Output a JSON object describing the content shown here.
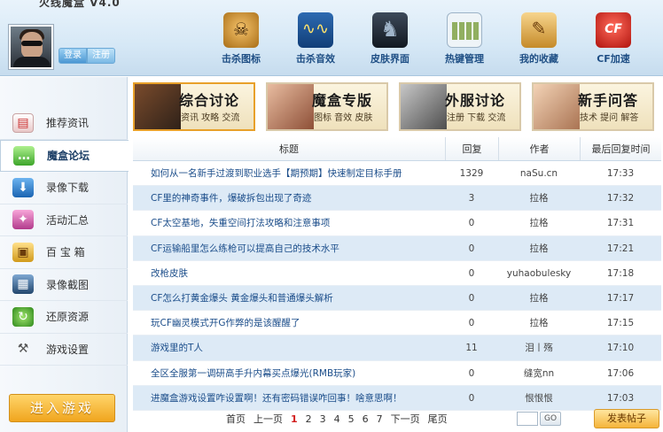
{
  "app": {
    "title": "火线魔盒 V4.0"
  },
  "user": {
    "login_label": "登录",
    "register_label": "注册"
  },
  "toolbar": {
    "items": [
      {
        "label": "击杀图标",
        "icon": "kill-icon"
      },
      {
        "label": "击杀音效",
        "icon": "sound-icon"
      },
      {
        "label": "皮肤界面",
        "icon": "skin-icon"
      },
      {
        "label": "热键管理",
        "icon": "hotkey-icon"
      },
      {
        "label": "我的收藏",
        "icon": "favorites-icon"
      },
      {
        "label": "CF加速",
        "icon": "cf-icon"
      }
    ]
  },
  "sidebar": {
    "items": [
      {
        "label": "推荐资讯",
        "icon": "news-icon"
      },
      {
        "label": "魔盒论坛",
        "icon": "forum-icon",
        "active": true
      },
      {
        "label": "录像下载",
        "icon": "download-icon"
      },
      {
        "label": "活动汇总",
        "icon": "gift-icon"
      },
      {
        "label": "百 宝 箱",
        "icon": "treasure-box-icon"
      },
      {
        "label": "录像截图",
        "icon": "screenshot-icon"
      },
      {
        "label": "还原资源",
        "icon": "restore-icon"
      },
      {
        "label": "游戏设置",
        "icon": "settings-icon"
      }
    ],
    "enter_game_label": "进入游戏"
  },
  "banners": [
    {
      "title": "综合讨论",
      "subtitle": "资讯 攻略 交流"
    },
    {
      "title": "魔盒专版",
      "subtitle": "图标 音效 皮肤"
    },
    {
      "title": "外服讨论",
      "subtitle": "注册 下载 交流"
    },
    {
      "title": "新手问答",
      "subtitle": "技术 提问 解答"
    }
  ],
  "table": {
    "headers": {
      "title": "标题",
      "replies": "回复",
      "author": "作者",
      "last_reply": "最后回复时间"
    },
    "rows": [
      {
        "title": "如何从一名新手过渡到职业选手【期预期】快速制定目标手册",
        "replies": "1329",
        "author": "naSu.cn",
        "time": "17:33"
      },
      {
        "title": "CF里的神奇事件，爆破拆包出现了奇迹",
        "replies": "3",
        "author": "拉格",
        "time": "17:32"
      },
      {
        "title": "CF太空基地，失重空间打法攻略和注意事项",
        "replies": "0",
        "author": "拉格",
        "time": "17:31"
      },
      {
        "title": "CF运输船里怎么练枪可以提高自己的技术水平",
        "replies": "0",
        "author": "拉格",
        "time": "17:21"
      },
      {
        "title": "改枪皮肤",
        "replies": "0",
        "author": "yuhaobulesky",
        "time": "17:18"
      },
      {
        "title": "CF怎么打黄金爆头 黄金爆头和普通爆头解析",
        "replies": "0",
        "author": "拉格",
        "time": "17:17"
      },
      {
        "title": "玩CF幽灵模式开G作弊的是该醒醒了",
        "replies": "0",
        "author": "拉格",
        "time": "17:15"
      },
      {
        "title": "游戏里的T人",
        "replies": "11",
        "author": "泪丨殇",
        "time": "17:10"
      },
      {
        "title": "全区全服第一调研高手升内幕买点爆光(RMB玩家)",
        "replies": "0",
        "author": "缝宽nn",
        "time": "17:06"
      },
      {
        "title": "进魔盒游戏设置咋设置啊！还有密码错误咋回事！啥意思啊！",
        "replies": "0",
        "author": "恨恨恨",
        "time": "17:03"
      }
    ]
  },
  "pagination": {
    "first": "首页",
    "prev": "上一页",
    "pages": [
      "1",
      "2",
      "3",
      "4",
      "5",
      "6",
      "7"
    ],
    "current": "1",
    "next": "下一页",
    "last": "尾页",
    "go_label": "GO",
    "post_label": "发表帖子"
  }
}
